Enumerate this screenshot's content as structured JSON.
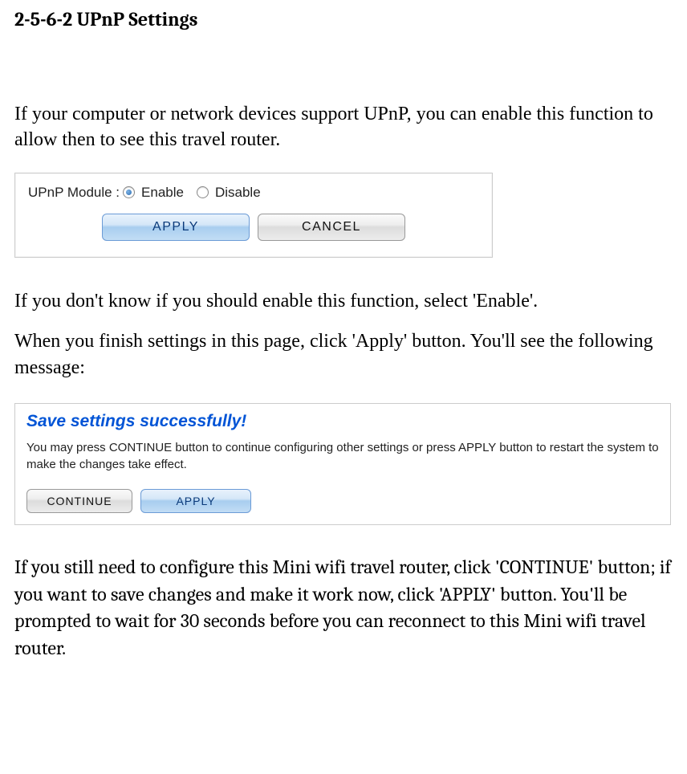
{
  "heading": "2-5-6-2 UPnP Settings",
  "paragraph1": "If your computer or network devices support UPnP, you can enable this function to allow then to see this travel router.",
  "panel1": {
    "label": "UPnP Module :",
    "option_enable": "Enable",
    "option_disable": "Disable",
    "selected": "Enable",
    "apply_label": "APPLY",
    "cancel_label": "CANCEL"
  },
  "paragraph2": "If you don't know if you should enable this function, select 'Enable'.",
  "paragraph3": "When you finish settings in this page, click 'Apply' button. You'll see the following message:",
  "panel2": {
    "title": "Save settings successfully!",
    "text": "You may press CONTINUE button to continue configuring other settings or press APPLY button to restart the system to make the changes take effect.",
    "continue_label": "CONTINUE",
    "apply_label": "APPLY"
  },
  "paragraph4": "If you still need to configure this Mini wifi travel router, click 'CONTINUE' button; if you want to save changes and make it work now, click 'APPLY' button. You'll be prompted to wait for 30 seconds before you can reconnect to this Mini wifi travel router."
}
